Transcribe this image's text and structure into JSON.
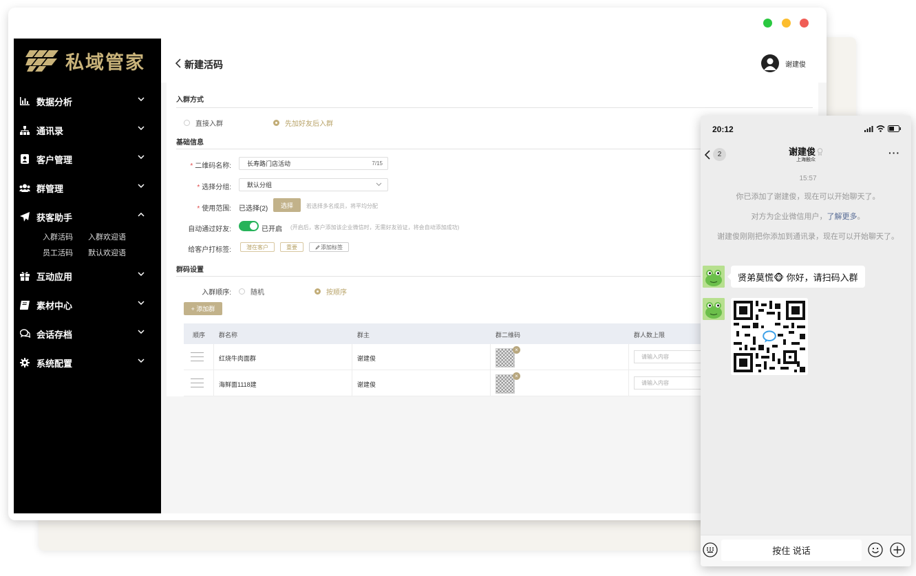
{
  "app": {
    "logo_text": "私域管家",
    "window_controls": [
      "green",
      "yellow",
      "red"
    ]
  },
  "sidebar": {
    "menu": [
      {
        "label": "数据分析",
        "icon": "bar-chart-icon",
        "expanded": false
      },
      {
        "label": "通讯录",
        "icon": "org-chart-icon",
        "expanded": false
      },
      {
        "label": "客户管理",
        "icon": "contact-card-icon",
        "expanded": false
      },
      {
        "label": "群管理",
        "icon": "group-icon",
        "expanded": false
      },
      {
        "label": "获客助手",
        "icon": "paper-plane-icon",
        "expanded": true
      },
      {
        "label": "互动应用",
        "icon": "gift-icon",
        "expanded": false
      },
      {
        "label": "素材中心",
        "icon": "book-icon",
        "expanded": false
      },
      {
        "label": "会话存档",
        "icon": "chat-bubbles-icon",
        "expanded": false
      },
      {
        "label": "系统配置",
        "icon": "gear-icon",
        "expanded": false
      }
    ],
    "submenu": [
      "入群活码",
      "入群欢迎语",
      "员工活码",
      "默认欢迎语"
    ]
  },
  "header": {
    "title": "新建活码",
    "user_name": "谢建俊"
  },
  "form": {
    "section_join": "入群方式",
    "join_options": [
      "直接入群",
      "先加好友后入群"
    ],
    "join_selected": 1,
    "section_basic": "基础信息",
    "qr_name_label": "二维码名称:",
    "qr_name_value": "长寿路门店活动",
    "qr_name_count": "7/15",
    "group_label": "选择分组:",
    "group_value": "默认分组",
    "scope_label": "使用范围:",
    "scope_value": "已选择(2)",
    "scope_button": "选择",
    "scope_hint": "若选择多名成员，将平均分配",
    "auto_friend_label": "自动通过好友:",
    "auto_friend_state": "已开启",
    "auto_friend_enabled": true,
    "auto_friend_hint": "(开启后，客户添加该企业微信时，无需好友验证，将会自动添加成功)",
    "tags_label": "给客户打标签:",
    "tags": [
      "潜在客户",
      "重要"
    ],
    "add_tag": "添加标签",
    "section_group": "群码设置",
    "order_label": "入群顺序:",
    "order_options": [
      "随机",
      "按顺序"
    ],
    "order_selected": 1,
    "add_group_button": "+ 添加群"
  },
  "table": {
    "headers": [
      "顺序",
      "群名称",
      "群主",
      "群二维码",
      "群人数上限"
    ],
    "rows": [
      {
        "name": "红烧牛肉面群",
        "owner": "谢建俊",
        "limit_placeholder": "请输入内容"
      },
      {
        "name": "海鲜面1118建",
        "owner": "谢建俊",
        "limit_placeholder": "请输入内容"
      }
    ]
  },
  "phone": {
    "time": "20:12",
    "unread": "2",
    "contact_name": "谢建俊",
    "contact_company": "上海触众",
    "chat_time": "15:57",
    "sys_msg_1": "你已添加了谢建俊，现在可以开始聊天了。",
    "sys_msg_2_prefix": "对方为企业微信用户，",
    "sys_msg_2_link": "了解更多",
    "sys_msg_2_suffix": "。",
    "sys_msg_3": "谢建俊刚刚把你添加到通讯录，现在可以开始聊天了。",
    "message_1": "贤弟莫慌🐵 你好，请扫码入群",
    "hold_to_talk": "按住 说话"
  }
}
